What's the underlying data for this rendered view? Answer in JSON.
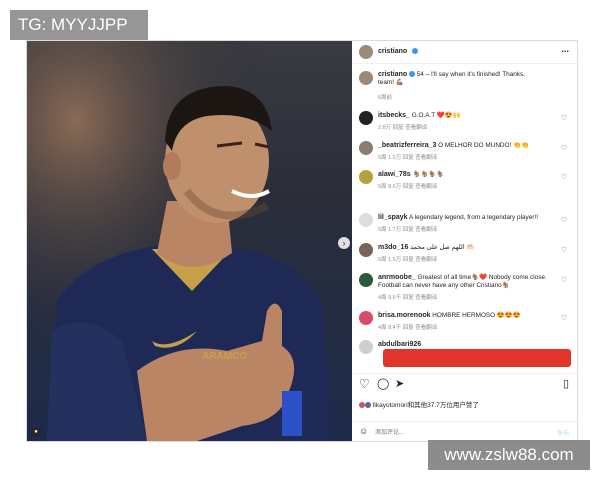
{
  "watermark_top": "TG: MYYJJPP",
  "watermark_bottom": "www.zslw88.com",
  "header": {
    "username": "cristiano",
    "more": "..."
  },
  "caption": {
    "username": "cristiano",
    "text": "54 – I'll say when it's finished! Thanks, team! 💪🏽",
    "meta": "6周前"
  },
  "comments": [
    {
      "user": "itsbecks_",
      "text": "G.O.A.T ❤️😍🙌",
      "meta": "2.8万 回复 查看翻译"
    },
    {
      "user": "_beatrizferreira_3",
      "text": "O MELHOR DO MUNDO! 👏👏",
      "meta": "5周 1.2万 回复 查看翻译"
    },
    {
      "user": "alawi_78s",
      "text": "🐐🐐🐐🐐",
      "meta": "5周 8.6万 回复 查看翻译"
    },
    {
      "user": "lil_spayk",
      "text": "A legendary legend, from a legendary player!!",
      "meta": "5周 1.7万 回复 查看翻译"
    },
    {
      "user": "m3do_16",
      "text": "اللهم صل على محمد 🤲🏻",
      "meta": "5周 1.5万 回复 查看翻译"
    },
    {
      "user": "anrmoobe_",
      "text": "Greatest of all time🐐❤️ Nobody come close. Football can never have any other Cristiano🐐",
      "meta": "4周 9.6千 回复 查看翻译"
    },
    {
      "user": "brisa.morenook",
      "text": "HOMBRE HERMOSO 😍😍😍",
      "meta": "4周 8.4千 回复 查看翻译"
    },
    {
      "user": "abdulbari926",
      "text": "",
      "meta": ""
    }
  ],
  "likes": {
    "text": "fikayotomori和其他37.7万位用户赞了"
  },
  "add_comment": {
    "placeholder": "添加评论...",
    "post": "发布"
  },
  "jersey": {
    "sponsor": "ARAMCO"
  },
  "colors": {
    "verified": "#3897f0",
    "jersey": "#1e2a55",
    "heart_red": "#ed4956"
  }
}
